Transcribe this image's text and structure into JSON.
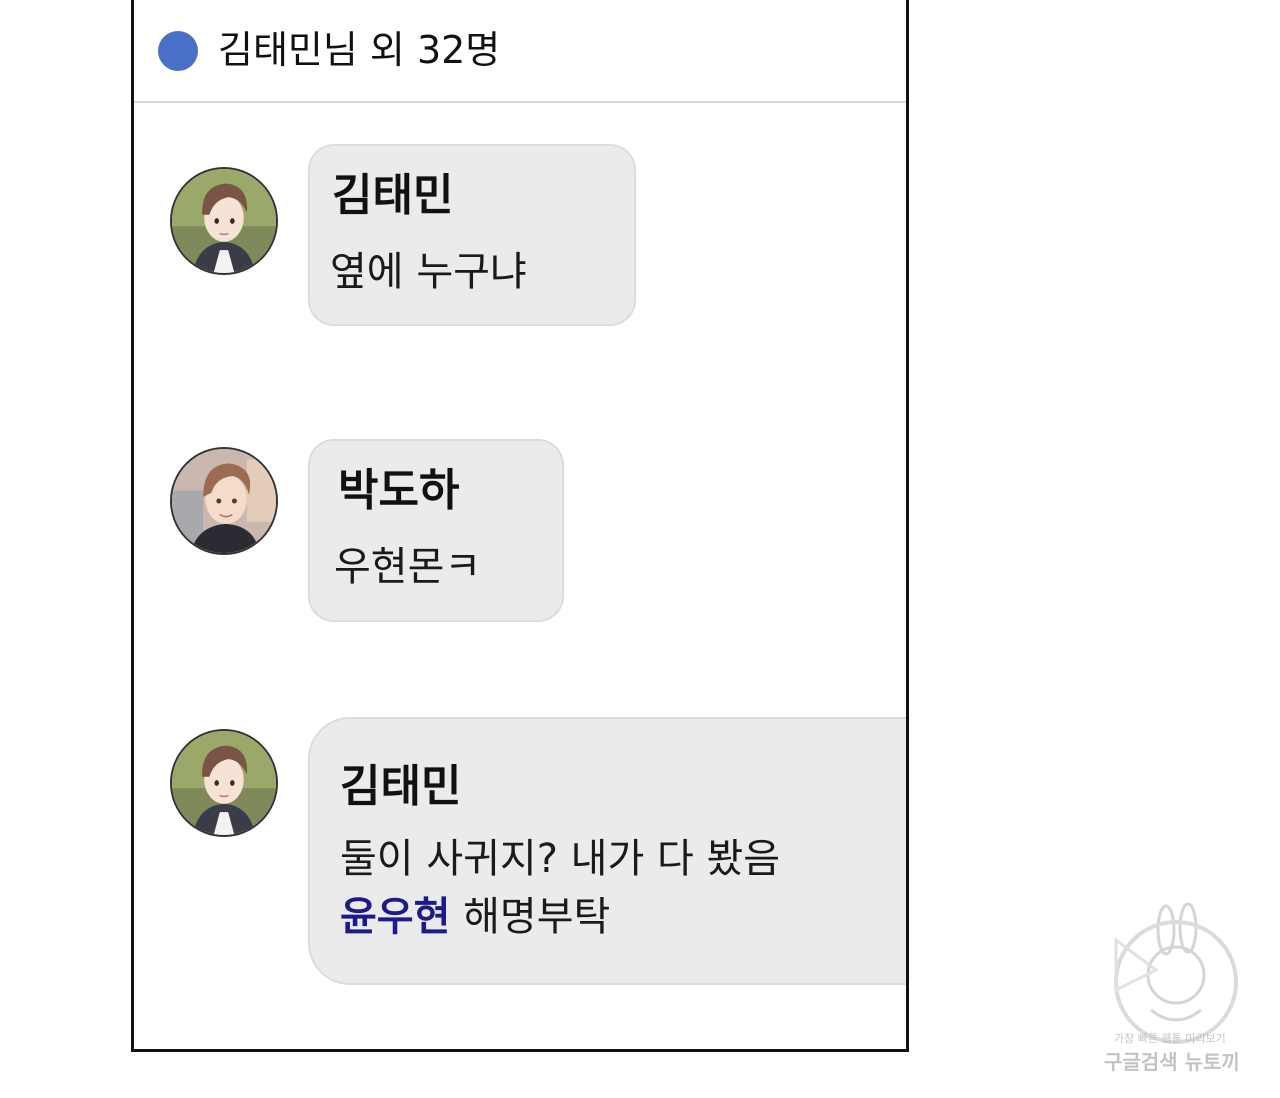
{
  "header": {
    "title": "김태민님 외 32명",
    "dot_color": "#4a6fc6"
  },
  "messages": [
    {
      "sender": "김태민",
      "text": "옆에 누구냐",
      "avatar_icon": "avatar-kim-taemin"
    },
    {
      "sender": "박도하",
      "text": "우현몬ㅋ",
      "avatar_icon": "avatar-park-doha"
    },
    {
      "sender": "김태민",
      "text_line1": "둘이 사귀지? 내가 다 봤음",
      "mention": "윤우현",
      "text_line2_rest": " 해명부탁",
      "avatar_icon": "avatar-kim-taemin"
    }
  ],
  "colors": {
    "bubble": "#ebebeb",
    "mention": "#1e1a8a"
  },
  "watermark": {
    "line1": "가장 빠른 웹툰 미리보기",
    "line2": "구글검색 뉴토끼"
  }
}
